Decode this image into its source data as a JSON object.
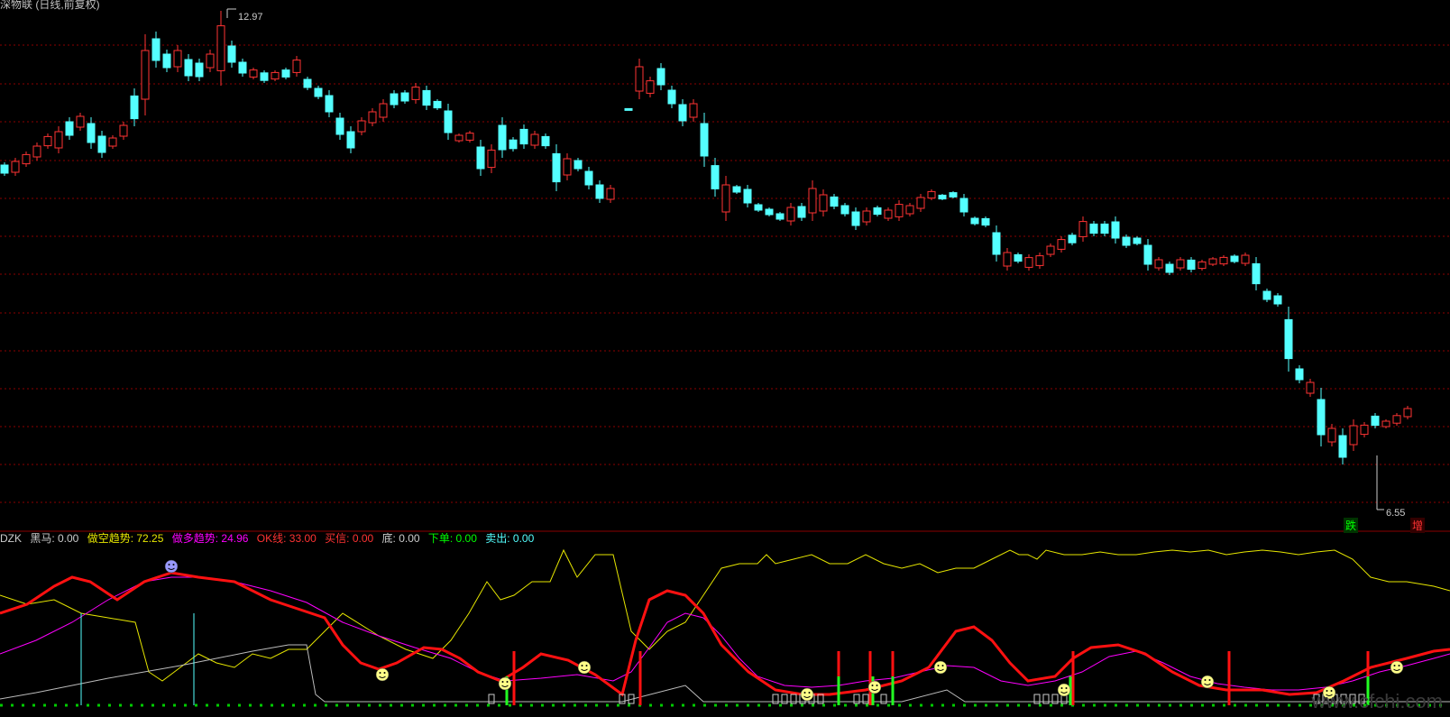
{
  "window": {
    "title": "深物联 (日线,前复权)"
  },
  "price_chart": {
    "high_label": "12.97",
    "low_label": "6.55",
    "signals": {
      "fall": "跌",
      "rise": "增"
    },
    "colors": {
      "up": "#ff3333",
      "down": "#54ffff",
      "grid": "#8b0000"
    }
  },
  "indicator": {
    "name": "DZK",
    "fields": [
      {
        "label": "黑马:",
        "value": "0.00",
        "color": "#cccccc"
      },
      {
        "label": "做空趋势:",
        "value": "72.25",
        "color": "#e6e600"
      },
      {
        "label": "做多趋势:",
        "value": "24.96",
        "color": "#ff00ff"
      },
      {
        "label": "OK线:",
        "value": "33.00",
        "color": "#ff3333"
      },
      {
        "label": "买信:",
        "value": "0.00",
        "color": "#ff3333"
      },
      {
        "label": "底:",
        "value": "0.00",
        "color": "#cccccc"
      },
      {
        "label": "下单:",
        "value": "0.00",
        "color": "#00ff00"
      },
      {
        "label": "卖出:",
        "value": "0.00",
        "color": "#54ffff"
      }
    ]
  },
  "watermark": "www.cfchi.com"
}
